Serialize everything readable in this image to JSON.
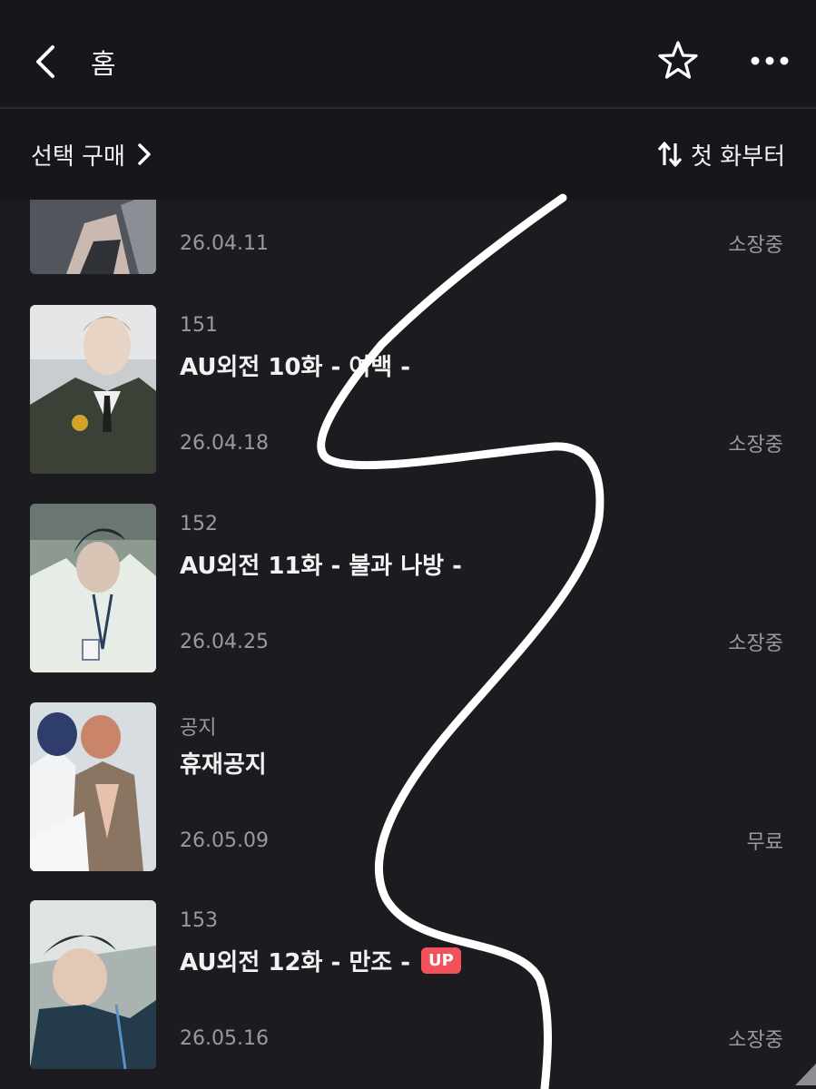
{
  "header": {
    "title": "홈",
    "icons": [
      "back-arrow-icon",
      "star-icon",
      "more-icon"
    ]
  },
  "subbar": {
    "select_buy_label": "선택 구매",
    "sort_label": "첫 화부터"
  },
  "episodes": [
    {
      "number": "",
      "title": "",
      "date": "26.04.11",
      "status": "소장중",
      "badge": ""
    },
    {
      "number": "151",
      "title": "AU외전 10화 - 여백 -",
      "date": "26.04.18",
      "status": "소장중",
      "badge": ""
    },
    {
      "number": "152",
      "title": "AU외전 11화 - 불과 나방 -",
      "date": "26.04.25",
      "status": "소장중",
      "badge": ""
    },
    {
      "number": "공지",
      "title": "휴재공지",
      "date": "26.05.09",
      "status": "무료",
      "badge": ""
    },
    {
      "number": "153",
      "title": "AU외전 12화 - 만조 -",
      "date": "26.05.16",
      "status": "소장중",
      "badge": "UP"
    }
  ],
  "colors": {
    "background": "#1c1b20",
    "header": "#17161b",
    "badge": "#f2535b",
    "muted_text": "#9a99a0"
  }
}
